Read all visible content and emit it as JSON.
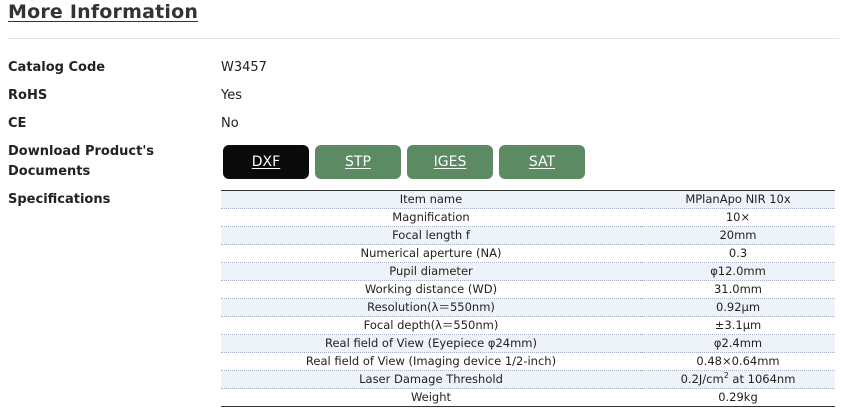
{
  "section": {
    "title": "More Information"
  },
  "info_rows": [
    {
      "label": "Catalog Code",
      "value": "W3457"
    },
    {
      "label": "RoHS",
      "value": "Yes"
    },
    {
      "label": "CE",
      "value": "No"
    }
  ],
  "documents": {
    "label_line1": "Download Product's",
    "label_line2": "Documents",
    "buttons": [
      {
        "label": "DXF",
        "active": true
      },
      {
        "label": "STP",
        "active": false
      },
      {
        "label": "IGES",
        "active": false
      },
      {
        "label": "SAT",
        "active": false
      }
    ]
  },
  "specifications": {
    "label": "Specifications",
    "rows": [
      {
        "name": "Item name",
        "value": "MPlanApo NIR 10x"
      },
      {
        "name": "Magnification",
        "value": "10×"
      },
      {
        "name": "Focal length f",
        "value": "20mm"
      },
      {
        "name": "Numerical aperture (NA)",
        "value": "0.3"
      },
      {
        "name": "Pupil diameter",
        "value": "φ12.0mm"
      },
      {
        "name": "Working distance (WD)",
        "value": "31.0mm"
      },
      {
        "name": "Resolution(λ＝550nm)",
        "value": "0.92μm"
      },
      {
        "name": "Focal depth(λ＝550nm)",
        "value": "±3.1μm"
      },
      {
        "name": "Real field of View (Eyepiece φ24mm)",
        "value": "φ2.4mm"
      },
      {
        "name": "Real field of View (Imaging device 1/2-inch)",
        "value": "0.48×0.64mm"
      },
      {
        "name": "Laser Damage Threshold",
        "value": "0.2J/cm",
        "value_sup": "2",
        "value_suffix": " at 1064nm"
      },
      {
        "name": "Weight",
        "value": "0.29kg"
      }
    ]
  },
  "colors": {
    "button_green": "#5b8a63",
    "button_active": "#0a0a0a",
    "stripe": "#edf3f8"
  }
}
